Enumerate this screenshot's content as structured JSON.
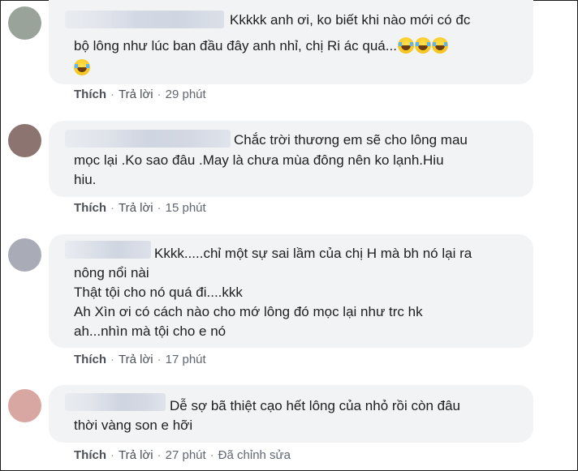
{
  "comments": [
    {
      "text_lines": [
        "Kkkkk anh ơi, ko biết khi nào mới có đc",
        "bộ lông như lúc ban đầu đây anh nhỉ, chị Ri ác quá..."
      ],
      "emoji_count": 4,
      "emoji_icon": "laughing-tears-icon",
      "avatar_color": "#9aa39a",
      "actions": {
        "like": "Thích",
        "reply": "Trả lời",
        "time": "29 phút"
      }
    },
    {
      "text_lines": [
        "Chắc trời thương em sẽ cho lông mau",
        "mọc lại .Ko sao đâu .May là chưa mùa đông nên ko lạnh.Hiu",
        "hiu."
      ],
      "avatar_color": "#8c7470",
      "actions": {
        "like": "Thích",
        "reply": "Trả lời",
        "time": "15 phút"
      }
    },
    {
      "text_lines": [
        "Kkkk.....chỉ một sự sai lầm của chị H mà bh nó lại ra",
        "nông nổi nài",
        "Thật tội cho nó quá đi....kkk",
        "Ah Xìn ơi có cách nào cho mớ lông đó mọc lại như trc hk",
        "ah...nhìn mà tội cho e nó"
      ],
      "avatar_color": "#a9abb7",
      "actions": {
        "like": "Thích",
        "reply": "Trả lời",
        "time": "17 phút"
      }
    },
    {
      "text_lines": [
        "Dễ sợ bã thiệt cạo hết lông của nhỏ rồi còn đâu",
        "thời vàng son e hỡi"
      ],
      "avatar_color": "#d8a7a2",
      "actions": {
        "like": "Thích",
        "reply": "Trả lời",
        "time": "27 phút",
        "edited": "Đã chỉnh sửa"
      }
    }
  ]
}
